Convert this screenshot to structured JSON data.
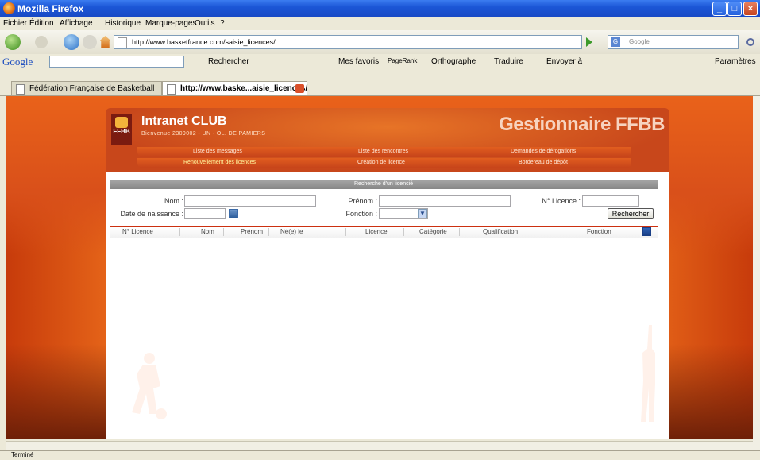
{
  "window": {
    "title": "Mozilla Firefox",
    "buttons": [
      "_",
      "□",
      "×"
    ]
  },
  "menu": [
    "Fichier",
    "Édition",
    "Affichage",
    "Historique",
    "Marque-pages",
    "Outils",
    "?"
  ],
  "navbar": {
    "url": "http://www.basketfrance.com/saisie_licences/",
    "search_placeholder": "Google"
  },
  "google_toolbar": {
    "logo": "Google",
    "items": [
      "Rechercher",
      "Mes favoris",
      "PageRank",
      "Orthographe",
      "Traduire",
      "Envoyer à",
      "Paramètres"
    ]
  },
  "tabs": [
    {
      "label": "Fédération Française de Basketball",
      "active": false
    },
    {
      "label": "http://www.baske...aisie_licences/",
      "active": true
    }
  ],
  "header": {
    "brand": "Intranet CLUB",
    "welcome": "Bienvenue 2309002 - UN - OL. DE PAMIERS",
    "gestionnaire": "Gestionnaire FFBB",
    "logo_text": "FFBB"
  },
  "nav": {
    "row1": [
      "Liste des messages",
      "Liste des rencontres",
      "Demandes de dérogations"
    ],
    "row2": [
      "Renouvellement des licences",
      "Création de licence",
      "Bordereau de dépôt"
    ],
    "selected": "Renouvellement des licences"
  },
  "form": {
    "title": "Recherche d'un licencié",
    "nom_label": "Nom :",
    "prenom_label": "Prénom :",
    "licence_label": "N° Licence :",
    "date_label": "Date de naissance :",
    "fonction_label": "Fonction :",
    "search_button": "Rechercher"
  },
  "table": {
    "columns": [
      "N° Licence",
      "Nom",
      "Prénom",
      "Né(e) le",
      "Licence",
      "Catégorie",
      "Qualification",
      "Fonction"
    ]
  },
  "status": "Terminé"
}
